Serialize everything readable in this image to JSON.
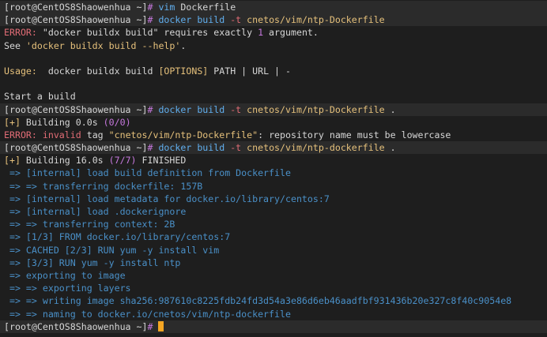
{
  "prompt": "[root@CentOS8Shaowenhua ~]",
  "hash": "#",
  "lines": {
    "l1": {
      "cmd": "vim",
      "rest": "Dockerfile"
    },
    "l2": {
      "cmd": "docker build",
      "flag": "-t",
      "arg": "cnetos/vim/ntp-Dockerfile"
    },
    "l3": {
      "error": "ERROR:",
      "text1": " \"docker buildx build\" requires exactly ",
      "num": "1",
      "text2": " argument."
    },
    "l4": {
      "text1": "See ",
      "quoted": "'docker buildx build --help'",
      "text2": "."
    },
    "l6": {
      "label": "Usage:",
      "text1": "  docker buildx build ",
      "opts": "[OPTIONS]",
      "text2": " PATH | URL | -"
    },
    "l8": {
      "text": "Start a build"
    },
    "l9": {
      "cmd": "docker build",
      "flag": "-t",
      "arg": "cnetos/vim/ntp-Dockerfile",
      "rest": " ."
    },
    "l10": {
      "bracket": "[+]",
      "text1": " Building 0.0s ",
      "count": "(0/0)"
    },
    "l11": {
      "error": "ERROR:",
      "invalid": " invalid",
      "text1": " tag ",
      "quoted": "\"cnetos/vim/ntp-Dockerfile\"",
      "text2": ": repository name must be lowercase"
    },
    "l12": {
      "cmd": "docker build",
      "flag": "-t",
      "arg": "cnetos/vim/ntp-dockerfile",
      "rest": " ."
    },
    "l13": {
      "bracket": "[+]",
      "text1": " Building 16.0s ",
      "count": "(7/7)",
      "text2": " FINISHED"
    }
  },
  "build_steps": [
    " => [internal] load build definition from Dockerfile",
    " => => transferring dockerfile: 157B",
    " => [internal] load metadata for docker.io/library/centos:7",
    " => [internal] load .dockerignore",
    " => => transferring context: 2B",
    " => [1/3] FROM docker.io/library/centos:7",
    " => CACHED [2/3] RUN yum -y install vim",
    " => [3/3] RUN yum -y install ntp",
    " => exporting to image",
    " => => exporting layers",
    " => => writing image sha256:987610c8225fdb24fd3d54a3e86d6eb46aadfbf931436b20e327c8f40c9054e8",
    " => => naming to docker.io/cnetos/vim/ntp-dockerfile"
  ],
  "colors": {
    "background": "#1e1e1e",
    "error": "#e06c75",
    "command": "#61afef",
    "argument": "#e5c07b",
    "step": "#4a90c8",
    "cursor": "#f5a623"
  }
}
